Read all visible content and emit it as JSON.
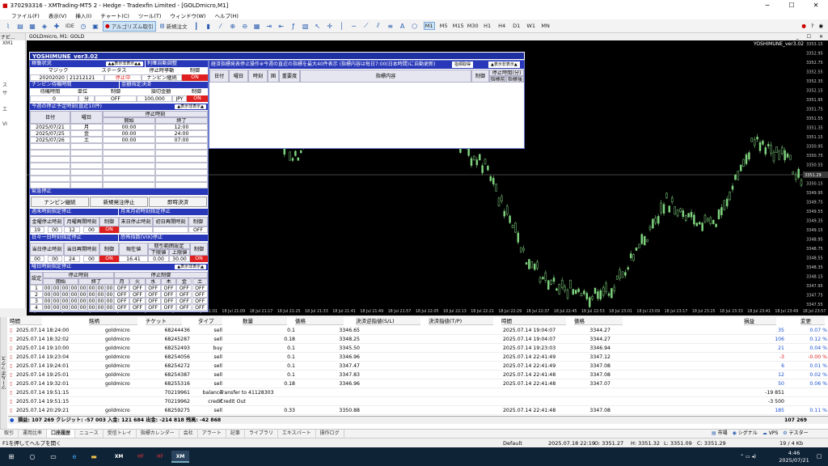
{
  "window": {
    "title": "370293316 - XMTrading-MT5 2 - Hedge - Tradexfin Limited - [GOLDmicro,M1]"
  },
  "menu": [
    "ファイル(F)",
    "表示(V)",
    "挿入(I)",
    "チャート(C)",
    "ツール(T)",
    "ウィンドウ(W)",
    "ヘルプ(H)"
  ],
  "toolbar": {
    "ide": "IDE",
    "algo": "アルゴリズム取引",
    "neworder": "新規注文",
    "timeframes": [
      "M1",
      "M5",
      "M15",
      "M30",
      "H1",
      "H4",
      "D1",
      "W1",
      "MN"
    ]
  },
  "navigator": {
    "header": "ナビ...",
    "items": [
      "XM1",
      "",
      "",
      "",
      "",
      "ス",
      "サ",
      "",
      "エ",
      "",
      "VI"
    ]
  },
  "chart": {
    "header": "GOLDmicro, M1:  GOLD",
    "ea_label": "YOSHIMUNE_ver3.02",
    "price_labels": [
      "3353.10",
      "3352.45",
      "3351.80",
      "3351.15",
      "3350.50",
      "3349.85",
      "3349.20",
      "3348.55",
      "3347.90"
    ],
    "price_marks": [
      "3353.15",
      "3352.95",
      "3352.75",
      "3352.55",
      "3352.35",
      "3352.15",
      "3351.95",
      "3351.75",
      "3351.55",
      "3351.35",
      "3351.15",
      "3350.95",
      "3350.75",
      "3350.55",
      "3350.35",
      "3350.15",
      "3349.95",
      "3349.75",
      "3349.55",
      "3349.35",
      "3349.15",
      "3348.95",
      "3348.75",
      "3348.55",
      "3348.35",
      "3348.15",
      "3347.95",
      "3347.75",
      "3347.55"
    ],
    "current_price": "3351.29",
    "time_labels": [
      "18 Jul 2025",
      "18 Jul 20:21",
      "18 Jul 20:29",
      "18 Jul 20:37",
      "18 Jul 20:45",
      "18 Jul 20:53",
      "18 Jul 21:01",
      "18 Jul 21:09",
      "18 Jul 21:17",
      "18 Jul 21:25",
      "18 Jul 21:33",
      "18 Jul 21:41",
      "18 Jul 21:49",
      "18 Jul 21:57",
      "18 Jul 22:05",
      "18 Jul 22:13",
      "18 Jul 22:21",
      "18 Jul 22:29",
      "18 Jul 22:37",
      "18 Jul 22:45",
      "18 Jul 22:53",
      "18 Jul 23:01",
      "18 Jul 23:09",
      "18 Jul 23:17",
      "18 Jul 23:25",
      "18 Jul 23:33",
      "18 Jul 23:41",
      "18 Jul 23:49",
      "18 Jul 23:57"
    ]
  },
  "ea": {
    "title": "YOSHIMUNE_ver3.02",
    "status_title": "稼働状況",
    "status_btn": "▲▲表示非表示▲▲",
    "auto_title": "利確自動調整",
    "col_magic": "マジック",
    "col_status": "ステータス",
    "col_stop": "停止時挙動",
    "col_control": "制御",
    "magic_values": "20202020 | 21212121",
    "status_value": "停止中",
    "stop_value": "ナンピン継続",
    "control_value": "ON",
    "nanpin_title": "ナンピン待機時間",
    "amount_title": "金額指定決済",
    "wait_time": "待機時間",
    "unit": "単位",
    "settle_amount": "損切金額",
    "wait_val": "0",
    "unit_val": "分",
    "ctrl_off": "OFF",
    "amount_val": "100,000",
    "jpy": "JPY",
    "ctrl_on": "ON",
    "schedule_title": "今週の停止予定時刻(直近10件)",
    "schedule_btn": "▲表示非表示▲",
    "sch_date": "日付",
    "sch_day": "曜日",
    "sch_stop": "停止時刻",
    "sch_start": "開始",
    "sch_end": "終了",
    "schedule": [
      {
        "date": "2025/07/21",
        "day": "月",
        "start": "00:00",
        "end": "12:00"
      },
      {
        "date": "2025/07/25",
        "day": "金",
        "start": "00:00",
        "end": "24:00"
      },
      {
        "date": "2025/07/26",
        "day": "土",
        "start": "00:00",
        "end": "07:00"
      }
    ],
    "emergency_title": "緊急停止",
    "btn_nanpin": "ナンピン継続",
    "btn_neworder_stop": "新規発注停止",
    "btn_settle": "即時決済",
    "weekend_title": "週末時刻指定停止",
    "monthend_title": "月末月初時刻指定停止",
    "wk_h1": "金曜停止時刻",
    "wk_h2": "月曜再開時刻",
    "wk_h3": "制御",
    "me_h1": "末日停止時刻",
    "me_h2": "初日再開時刻",
    "me_h3": "制御",
    "wk_v1a": "19",
    "wk_v1b": "00",
    "wk_v2a": "12",
    "wk_v2b": "00",
    "wk_ctrl": "ON",
    "me_ctrl": "OFF",
    "daily_title": "日々一日時刻指定停止",
    "vix_title": "恐怖指数(VIX)停止",
    "dl_h1": "当日停止時刻",
    "dl_h2": "当日再開時刻",
    "dl_h3": "制御",
    "vix_cur": "現在値",
    "vix_range": "取引範囲設定",
    "vix_low": "下限値",
    "vix_high": "上限値",
    "vix_ctrl": "制御",
    "dl_v1a": "00",
    "dl_v1b": "00",
    "dl_v2a": "24",
    "dl_v2b": "00",
    "dl_ctrl": "ON",
    "vix_cur_val": "16.41",
    "vix_low_val": "0.00",
    "vix_high_val": "30.00",
    "vix_ctrl_val": "ON",
    "weekday_title": "曜日時刻指定停止",
    "weekday_btn": "▲表示非表示▲",
    "wd_setting": "設定",
    "wd_stop": "停止時刻",
    "wd_start": "開始",
    "wd_end": "終了",
    "wd_ctrl": "停止制御",
    "days": [
      "月",
      "火",
      "水",
      "木",
      "金",
      "土"
    ],
    "wd_rows": [
      "1",
      "2",
      "3",
      "4"
    ],
    "wd_time": "00",
    "wd_off": "OFF"
  },
  "news": {
    "title": "経済指標発表停止操作※今週の直近の指標を最大40件表示 (指標内容は毎日7:00(日本時間)に自動更新)",
    "btn1": "指標取得",
    "btn2": "▲表示非表示▲",
    "cols": [
      "日付",
      "曜日",
      "時刻",
      "国",
      "重要度",
      "指標内容",
      "制御",
      "停止時間(分)"
    ],
    "sub_before": "指標前",
    "sub_after": "指標後"
  },
  "history": {
    "cols": [
      "時間",
      "銘柄",
      "チケット",
      "タイプ",
      "数量",
      "価格",
      "決済逆指値(S/L)",
      "決済指値(T/P)",
      "時間",
      "価格",
      "損益",
      "変更"
    ],
    "rows": [
      {
        "t": "2025.07.14 18:24:00",
        "s": "goldmicro",
        "tk": "68244436",
        "ty": "sell",
        "v": "0.1",
        "p": "3346.65",
        "ct": "2025.07.14 19:04:07",
        "cp": "3344.27",
        "pl": "35",
        "ch": "0.07 %"
      },
      {
        "t": "2025.07.14 18:32:02",
        "s": "goldmicro",
        "tk": "68245287",
        "ty": "sell",
        "v": "0.18",
        "p": "3348.25",
        "ct": "2025.07.14 19:04:07",
        "cp": "3344.27",
        "pl": "106",
        "ch": "0.12 %"
      },
      {
        "t": "2025.07.14 19:10:00",
        "s": "goldmicro",
        "tk": "68252493",
        "ty": "buy",
        "v": "0.1",
        "p": "3345.50",
        "ct": "2025.07.14 19:23:03",
        "cp": "3346.94",
        "pl": "21",
        "ch": "0.04 %"
      },
      {
        "t": "2025.07.14 19:23:04",
        "s": "goldmicro",
        "tk": "68254056",
        "ty": "sell",
        "v": "0.1",
        "p": "3346.96",
        "ct": "2025.07.14 22:41:49",
        "cp": "3347.12",
        "pl": "-3",
        "ch": "-0.00 %"
      },
      {
        "t": "2025.07.14 19:24:01",
        "s": "goldmicro",
        "tk": "68254272",
        "ty": "sell",
        "v": "0.1",
        "p": "3347.47",
        "ct": "2025.07.14 22:41:49",
        "cp": "3347.08",
        "pl": "6",
        "ch": "0.01 %"
      },
      {
        "t": "2025.07.14 19:25:01",
        "s": "goldmicro",
        "tk": "68254387",
        "ty": "sell",
        "v": "0.1",
        "p": "3347.83",
        "ct": "2025.07.14 22:41:48",
        "cp": "3347.08",
        "pl": "12",
        "ch": "0.02 %"
      },
      {
        "t": "2025.07.14 19:32:01",
        "s": "goldmicro",
        "tk": "68255316",
        "ty": "sell",
        "v": "0.18",
        "p": "3346.96",
        "ct": "2025.07.14 22:41:48",
        "cp": "3347.07",
        "pl": "50",
        "ch": "0.06 %"
      },
      {
        "t": "2025.07.14 19:51:15",
        "s": "",
        "tk": "70219961",
        "ty": "balance",
        "v": "",
        "p": "",
        "note": "Transfer to 41128303",
        "ct": "",
        "cp": "",
        "pl": "-19 851",
        "ch": ""
      },
      {
        "t": "2025.07.14 19:51:15",
        "s": "",
        "tk": "70219962",
        "ty": "credit",
        "v": "",
        "p": "",
        "note": "Credit Out",
        "ct": "",
        "cp": "",
        "pl": "-3 500",
        "ch": ""
      },
      {
        "t": "2025.07.14 20:29:21",
        "s": "goldmicro",
        "tk": "68259275",
        "ty": "sell",
        "v": "0.33",
        "p": "3350.88",
        "ct": "2025.07.14 22:41:48",
        "cp": "3347.08",
        "pl": "185",
        "ch": "0.11 %"
      }
    ],
    "summary": "損益: 107 269  クレジット: -57 003  入金: 121 684  出金: -214 818  残高: -42 868",
    "summary_right": "107 269"
  },
  "tabs": [
    "取引",
    "運用比率",
    "口座履歴",
    "ニュース",
    "受信トレイ",
    "指標カレンダー",
    "会社",
    "アラート",
    "記事",
    "ライブラリ",
    "エキスパート",
    "操作ログ"
  ],
  "active_tab": "口座履歴",
  "side_tab": "ツールボックス",
  "status": {
    "help": "F1を押してヘルプを開く",
    "profile": "Default",
    "datetime": "2025.07.18 22:19",
    "open": "O: 3351.27",
    "high": "H: 3351.32",
    "low": "L: 3351.09",
    "close": "C: 3351.29",
    "market": "市場",
    "signals": "シグナル",
    "vps": "VPS",
    "tester": "テスター",
    "traffic": "19 / 4 Kb"
  },
  "taskbar": {
    "time": "4:46",
    "date": "2025/07/21"
  }
}
